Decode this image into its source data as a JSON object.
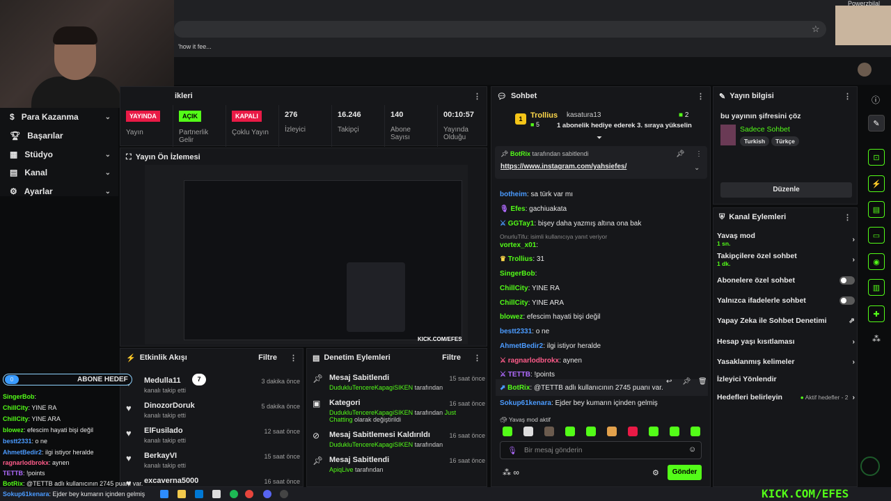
{
  "browser": {
    "tab_hint": "'how it fee...",
    "pip_label": "Powerzbilal"
  },
  "leftnav": [
    {
      "label": "Para Kazanma",
      "icon": "money-icon",
      "chev": "⌄"
    },
    {
      "label": "Başarılar",
      "icon": "trophy-icon",
      "chev": ""
    },
    {
      "label": "Stüdyo",
      "icon": "studio-icon",
      "chev": "⌄"
    },
    {
      "label": "Kanal",
      "icon": "channel-icon",
      "chev": "⌄"
    },
    {
      "label": "Ayarlar",
      "icon": "gear-icon",
      "chev": "⌄"
    }
  ],
  "stats_panel": {
    "title": "ikleri",
    "items": [
      {
        "badge": "YAYINDA",
        "label": "Yayın"
      },
      {
        "badge": "AÇIK",
        "label": "Partnerlik Gelir"
      },
      {
        "badge": "KAPALI",
        "label": "Çoklu Yayın"
      },
      {
        "value": "276",
        "label": "İzleyici"
      },
      {
        "value": "16.246",
        "label": "Takipçi"
      },
      {
        "value": "140",
        "label": "Abone Sayısı"
      },
      {
        "value": "00:10:57",
        "label": "Yayında Olduğu"
      }
    ]
  },
  "preview": {
    "title": "Yayın Ön İzlemesi",
    "watermark": "KICK.COM/EFES"
  },
  "activity": {
    "title": "Etkinlik Akışı",
    "filter": "Filtre",
    "items": [
      {
        "name": "Medulla11",
        "sub": "kanalı takip etti",
        "time": "3 dakika önce"
      },
      {
        "name": "DinozorDoruk",
        "sub": "kanalı takip etti",
        "time": "5 dakika önce"
      },
      {
        "name": "ElFusilado",
        "sub": "kanalı takip etti",
        "time": "12 saat önce"
      },
      {
        "name": "BerkayVI",
        "sub": "kanalı takip etti",
        "time": "15 saat önce"
      },
      {
        "name": "excaverna5000",
        "sub": "",
        "time": "16 saat önce"
      }
    ]
  },
  "moderation": {
    "title": "Denetim Eylemleri",
    "filter": "Filtre",
    "items": [
      {
        "title": "Mesaj Sabitlendi",
        "user": "DudukluTencereKapagiSIKEN",
        "rest": " tarafından",
        "time": "15 saat önce"
      },
      {
        "title": "Kategori",
        "user": "DudukluTencereKapagiSIKEN",
        "rest": " tarafından ",
        "extra": "Just Chatting",
        "rest2": " olarak değiştirildi",
        "time": "16 saat önce"
      },
      {
        "title": "Mesaj Sabitlemesi Kaldırıldı",
        "user": "DudukluTencereKapagiSIKEN",
        "rest": " tarafından",
        "time": "16 saat önce"
      },
      {
        "title": "Mesaj Sabitlendi",
        "user": "ApiqLive",
        "rest": " tarafından",
        "time": "16 saat önce"
      }
    ]
  },
  "chat": {
    "title": "Sohbet",
    "sub_leader": {
      "name": "Trollius",
      "count": "5",
      "gifter": "kasatura13",
      "gift_count": "2",
      "message": "1 abonelik hediye ederek 3. sıraya yükselin"
    },
    "pinned": {
      "by": "BotRix",
      "by_suffix": "tarafından sabitlendi",
      "link": "https://www.instagram.com/yahsiefes/"
    },
    "lines": [
      {
        "user": "botheim",
        "color": "u-blue",
        "text": ": sa türk var mı"
      },
      {
        "user": "Efes",
        "color": "u-green",
        "text": ": gachiuakata"
      },
      {
        "user": "GGTay1",
        "color": "u-green",
        "text": ": bişey daha yazmış altına ona bak"
      },
      {
        "user": "vortex_x01",
        "color": "u-green",
        "text": ":"
      },
      {
        "user": "Trollius",
        "color": "u-green",
        "text": ": 31"
      },
      {
        "user": "SingerBob",
        "color": "u-green",
        "text": ":"
      },
      {
        "user": "ChillCity",
        "color": "u-green",
        "text": ": YINE RA"
      },
      {
        "user": "ChillCity",
        "color": "u-green",
        "text": ": YINE ARA"
      },
      {
        "user": "blowez",
        "color": "u-green",
        "text": ": efescim hayati bişi değil"
      },
      {
        "user": "bestt2331",
        "color": "u-blue",
        "text": ": o ne"
      },
      {
        "user": "AhmetBedir2",
        "color": "u-blue",
        "text": ": ilgi istiyor heralde"
      },
      {
        "user": "ragnarlodbrokx",
        "color": "u-pink",
        "text": ": aynen"
      },
      {
        "user": "TETTB",
        "color": "u-purple",
        "text": ": !points"
      },
      {
        "user": "BotRix",
        "color": "u-green",
        "text": ": @TETTB adlı kullanıcının 2745 puanı var."
      },
      {
        "user": "Sokup61kenara",
        "color": "u-blue",
        "text": ": Ejder bey kumarın içinden gelmiş"
      }
    ],
    "reply_hint": "OnurluTifu: isimli kullanıcıya yanıt veriyor",
    "slow_mode": "Yavaş mod aktif",
    "placeholder": "Bir mesaj gönderin",
    "send": "Gönder"
  },
  "stream_info": {
    "title": "Yayın bilgisi",
    "stream_title": "bu yayının şifresini çöz",
    "category": "Sadece Sohbet",
    "tags": [
      "Turkish",
      "Türkçe"
    ],
    "edit": "Düzenle"
  },
  "channel_actions": {
    "title": "Kanal Eylemleri",
    "items": [
      {
        "label": "Yavaş mod",
        "sub": "1 sn.",
        "kind": "chev"
      },
      {
        "label": "Takipçilere özel sohbet",
        "sub": "1 dk.",
        "kind": "chev"
      },
      {
        "label": "Abonelere özel sohbet",
        "sub": "",
        "kind": "toggle"
      },
      {
        "label": "Yalnızca ifadelerle sohbet",
        "sub": "",
        "kind": "toggle"
      },
      {
        "label": "Yapay Zeka ile Sohbet Denetimi",
        "sub": "",
        "kind": "ext"
      },
      {
        "label": "Hesap yaşı kısıtlaması",
        "sub": "",
        "kind": "chev"
      },
      {
        "label": "Yasaklanmış kelimeler",
        "sub": "",
        "kind": "chev"
      },
      {
        "label": "İzleyici Yönlendir",
        "sub": "",
        "kind": "none"
      },
      {
        "label": "Hedefleri belirleyin",
        "sub": "",
        "kind": "goal",
        "goal_text": "Aktif hedefler - 2"
      }
    ]
  },
  "overlay": {
    "goal_label": "ABONE HEDEF",
    "goal_start": "0",
    "goal_end": "7",
    "lines": [
      {
        "user": "SingerBob",
        "text": ":"
      },
      {
        "user": "ChillCity",
        "text": ": YINE RA"
      },
      {
        "user": "ChillCity",
        "text": ": YINE ARA"
      },
      {
        "user": "blowez",
        "text": ": efescim hayati bişi değil"
      },
      {
        "user": "bestt2331",
        "text": ": o ne"
      },
      {
        "user": "AhmetBedir2",
        "text": ": ilgi istiyor heralde"
      },
      {
        "user": "ragnarlodbrokx",
        "text": ": aynen"
      },
      {
        "user": "TETTB",
        "text": ": !points"
      },
      {
        "user": "BotRix",
        "text": ": @TETTB adlı kullanıcının 2745 puanı var."
      },
      {
        "user": "Sokup61kenara",
        "text": ": Ejder bey kumarın içinden gelmiş"
      }
    ],
    "brand": "KICK.COM/EFES"
  },
  "colors": {
    "accent": "#53fc18",
    "live": "#e91a46",
    "bg": "#0b0c0d",
    "panel": "#16171a"
  }
}
